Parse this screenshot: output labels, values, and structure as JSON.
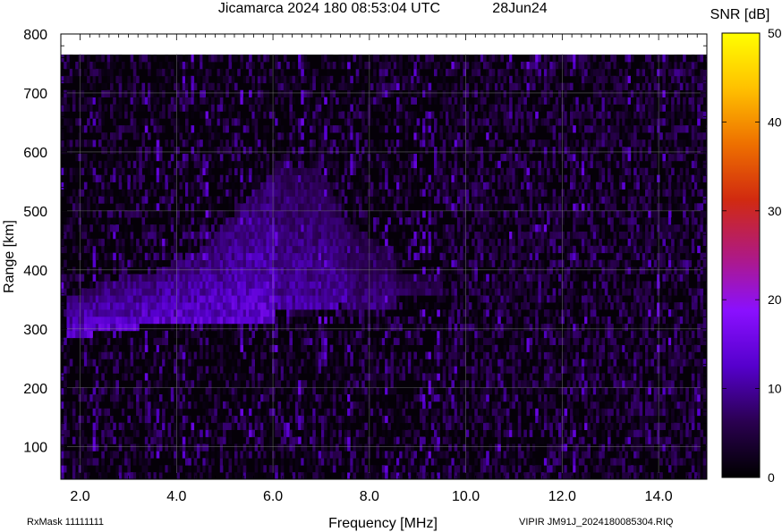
{
  "chart_data": {
    "type": "heatmap",
    "title": "Jicamarca 2024 180 08:53:04 UTC",
    "date": "28Jun24",
    "xlabel": "Frequency [MHz]",
    "ylabel": "Range [km]",
    "xlim": [
      1.6,
      15.0
    ],
    "ylim": [
      45,
      800
    ],
    "x_ticks": [
      "2.0",
      "4.0",
      "6.0",
      "8.0",
      "10.0",
      "12.0",
      "14.0"
    ],
    "y_ticks": [
      "100",
      "200",
      "300",
      "400",
      "500",
      "600",
      "700",
      "800"
    ],
    "colorbar": {
      "label": "SNR [dB]",
      "range": [
        0,
        50
      ],
      "ticks": [
        "0",
        "10",
        "20",
        "30",
        "40",
        "50"
      ],
      "colors": [
        "#000000",
        "#2a0050",
        "#5500cc",
        "#8a10ff",
        "#b01a80",
        "#d12a10",
        "#ee7000",
        "#ffc000",
        "#ffff00"
      ]
    },
    "echo_traces": [
      {
        "name": "F-region trace segment",
        "freq_mhz": [
          1.7,
          2.5,
          3.5,
          4.5,
          5.5,
          6.0
        ],
        "lower_range_km": [
          275,
          290,
          300,
          302,
          305,
          308
        ],
        "upper_range_km": [
          345,
          375,
          390,
          430,
          520,
          560
        ],
        "snr_db": 14
      },
      {
        "name": "F-region trace segment",
        "freq_mhz": [
          6.0,
          7.0,
          7.5
        ],
        "lower_range_km": [
          330,
          330,
          335
        ],
        "upper_range_km": [
          580,
          560,
          470
        ],
        "snr_db": 11
      },
      {
        "name": "F-region trace segment",
        "freq_mhz": [
          7.5,
          8.5
        ],
        "lower_range_km": [
          325,
          330
        ],
        "upper_range_km": [
          480,
          420
        ],
        "snr_db": 9
      },
      {
        "name": "F-region trace segment",
        "freq_mhz": [
          8.5,
          9.5
        ],
        "lower_range_km": [
          355,
          355
        ],
        "upper_range_km": [
          390,
          380
        ],
        "snr_db": 7
      }
    ],
    "noise_floor_snr_db": [
      0,
      8
    ],
    "grid": true
  },
  "footer": {
    "rxmask": "RxMask 11111111",
    "file": "VIPIR  JM91J_2024180085304.RIQ"
  }
}
